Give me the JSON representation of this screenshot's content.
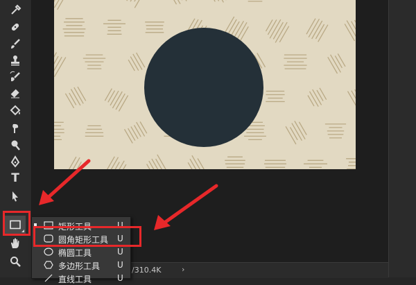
{
  "toolbar": {
    "tools": [
      {
        "id": "eyedropper",
        "icon": "eyedropper-icon"
      },
      {
        "id": "healing",
        "icon": "healing-brush-icon"
      },
      {
        "id": "brush",
        "icon": "brush-icon"
      },
      {
        "id": "clone",
        "icon": "clone-stamp-icon"
      },
      {
        "id": "history",
        "icon": "history-brush-icon"
      },
      {
        "id": "eraser",
        "icon": "eraser-icon"
      },
      {
        "id": "bucket",
        "icon": "paint-bucket-icon"
      },
      {
        "id": "smudge",
        "icon": "smudge-icon"
      },
      {
        "id": "dodge",
        "icon": "dodge-icon"
      },
      {
        "id": "pen",
        "icon": "pen-icon"
      },
      {
        "id": "type",
        "icon": "type-icon",
        "glyph": "T"
      },
      {
        "id": "path",
        "icon": "path-selection-icon"
      },
      {
        "id": "shape",
        "icon": "rectangle-tool-icon"
      },
      {
        "id": "hand",
        "icon": "hand-icon"
      },
      {
        "id": "zoom",
        "icon": "zoom-icon"
      }
    ]
  },
  "flyout": {
    "items": [
      {
        "label": "矩形工具",
        "key": "U",
        "icon": "rectangle-icon",
        "selected": true
      },
      {
        "label": "圆角矩形工具",
        "key": "U",
        "icon": "rounded-rectangle-icon",
        "selected": false
      },
      {
        "label": "椭圆工具",
        "key": "U",
        "icon": "ellipse-icon",
        "selected": false
      },
      {
        "label": "多边形工具",
        "key": "U",
        "icon": "polygon-icon",
        "selected": false
      },
      {
        "label": "直线工具",
        "key": "U",
        "icon": "line-icon",
        "selected": false
      }
    ]
  },
  "status": {
    "doc_size": "/310.4K",
    "arrow": "›"
  },
  "colors": {
    "highlight": "#e7282a",
    "circle": "#243038",
    "canvas_bg": "#e2d9c2",
    "pattern_line": "#b9a985"
  }
}
